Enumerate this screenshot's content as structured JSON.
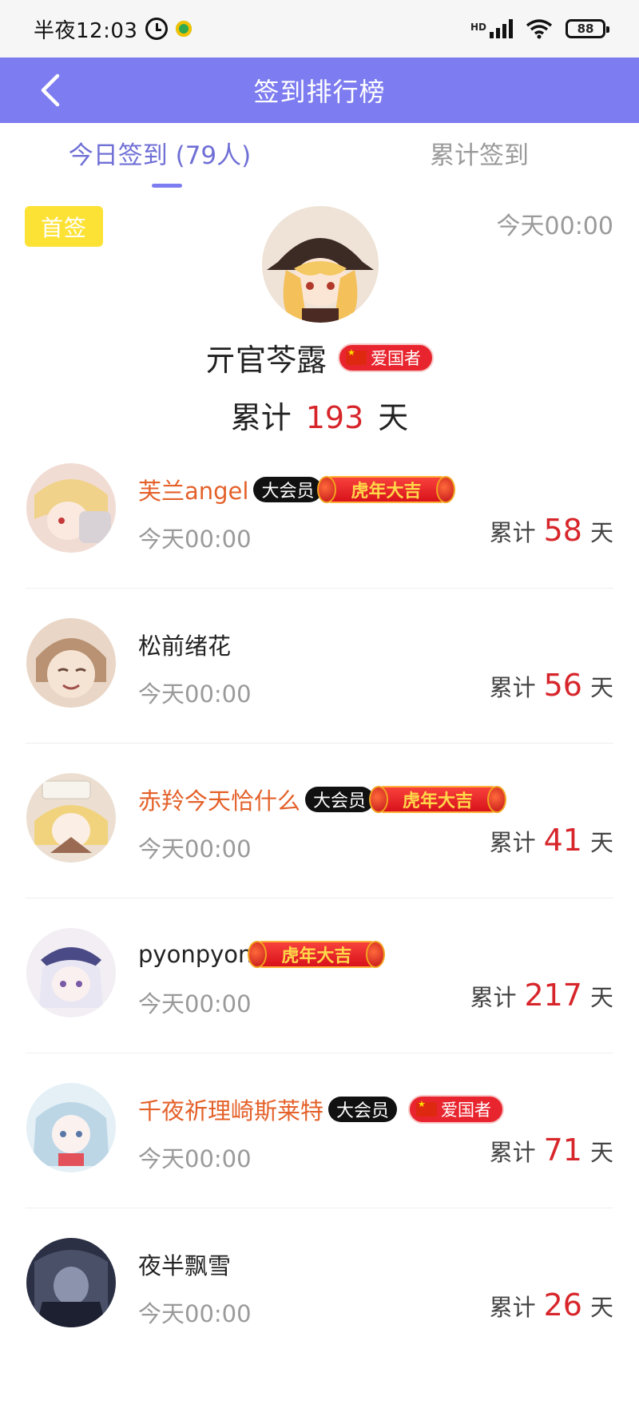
{
  "status_bar": {
    "time": "半夜12:03",
    "network": "HD",
    "battery": "88"
  },
  "header": {
    "title": "签到排行榜"
  },
  "tabs": [
    {
      "label": "今日签到 (79人)",
      "active": true
    },
    {
      "label": "累计签到",
      "active": false
    }
  ],
  "top_signer": {
    "badge": "首签",
    "time": "今天00:00",
    "name": "亓官芩露",
    "title_badge": "爱国者",
    "total_prefix": "累计",
    "total_days": "193",
    "total_suffix": "天"
  },
  "badge_text": {
    "vip": "大会员",
    "tiger": "虎年大吉",
    "patriot": "爱国者"
  },
  "list": [
    {
      "name": "芙兰angel",
      "time": "今天00:00",
      "total_prefix": "累计",
      "days": "58",
      "total_suffix": "天",
      "is_vip": true
    },
    {
      "name": "松前绪花",
      "time": "今天00:00",
      "total_prefix": "累计",
      "days": "56",
      "total_suffix": "天",
      "is_vip": false
    },
    {
      "name": "赤羚今天恰什么",
      "time": "今天00:00",
      "total_prefix": "累计",
      "days": "41",
      "total_suffix": "天",
      "is_vip": true
    },
    {
      "name": "pyonpyon",
      "time": "今天00:00",
      "total_prefix": "累计",
      "days": "217",
      "total_suffix": "天",
      "is_vip": false
    },
    {
      "name": "千夜祈理崎斯莱特",
      "time": "今天00:00",
      "total_prefix": "累计",
      "days": "71",
      "total_suffix": "天",
      "is_vip": true
    },
    {
      "name": "夜半飘雪",
      "time": "今天00:00",
      "total_prefix": "累计",
      "days": "26",
      "total_suffix": "天",
      "is_vip": false
    }
  ],
  "colors": {
    "accent": "#7d7cf0",
    "vip_name": "#e4612a",
    "count": "#d7262b",
    "first_badge": "#fde236"
  }
}
